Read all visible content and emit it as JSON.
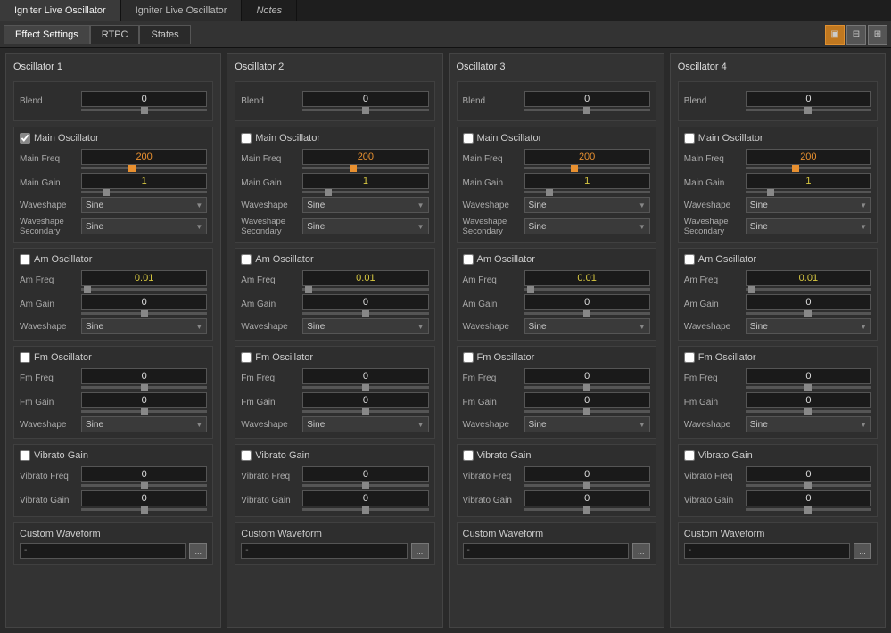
{
  "titleTabs": [
    {
      "label": "Igniter Live Oscillator",
      "active": true
    },
    {
      "label": "Igniter Live Oscillator",
      "active": false
    },
    {
      "label": "Notes",
      "active": false,
      "italic": true
    }
  ],
  "toolbar": {
    "tabs": [
      {
        "label": "Effect Settings",
        "active": true
      },
      {
        "label": "RTPC",
        "active": false
      },
      {
        "label": "States",
        "active": false
      }
    ],
    "icons": [
      {
        "name": "single-panel-icon",
        "symbol": "▣",
        "active": true
      },
      {
        "name": "dual-panel-icon",
        "symbol": "⊟",
        "active": false
      },
      {
        "name": "quad-panel-icon",
        "symbol": "⊞",
        "active": false
      }
    ]
  },
  "oscillators": [
    {
      "title": "Oscillator 1",
      "blend": "0",
      "mainOscillator": {
        "enabled": true,
        "mainFreq": "200",
        "mainGain": "1",
        "waveshape": "Sine",
        "waveshapeSecondary": "Sine"
      },
      "amOscillator": {
        "enabled": false,
        "amFreq": "0.01",
        "amGain": "0",
        "waveshape": "Sine"
      },
      "fmOscillator": {
        "enabled": false,
        "fmFreq": "0",
        "fmGain": "0",
        "waveshape": "Sine"
      },
      "vibrato": {
        "enabled": false,
        "vibratoFreq": "0",
        "vibratoGain": "0"
      },
      "customWaveform": "-"
    },
    {
      "title": "Oscillator 2",
      "blend": "0",
      "mainOscillator": {
        "enabled": false,
        "mainFreq": "200",
        "mainGain": "1",
        "waveshape": "Sine",
        "waveshapeSecondary": "Sine"
      },
      "amOscillator": {
        "enabled": false,
        "amFreq": "0.01",
        "amGain": "0",
        "waveshape": "Sine"
      },
      "fmOscillator": {
        "enabled": false,
        "fmFreq": "0",
        "fmGain": "0",
        "waveshape": "Sine"
      },
      "vibrato": {
        "enabled": false,
        "vibratoFreq": "0",
        "vibratoGain": "0"
      },
      "customWaveform": "-"
    },
    {
      "title": "Oscillator 3",
      "blend": "0",
      "mainOscillator": {
        "enabled": false,
        "mainFreq": "200",
        "mainGain": "1",
        "waveshape": "Sine",
        "waveshapeSecondary": "Sine"
      },
      "amOscillator": {
        "enabled": false,
        "amFreq": "0.01",
        "amGain": "0",
        "waveshape": "Sine"
      },
      "fmOscillator": {
        "enabled": false,
        "fmFreq": "0",
        "fmGain": "0",
        "waveshape": "Sine"
      },
      "vibrato": {
        "enabled": false,
        "vibratoFreq": "0",
        "vibratoGain": "0"
      },
      "customWaveform": "-"
    },
    {
      "title": "Oscillator 4",
      "blend": "0",
      "mainOscillator": {
        "enabled": false,
        "mainFreq": "200",
        "mainGain": "1",
        "waveshape": "Sine",
        "waveshapeSecondary": "Sine"
      },
      "amOscillator": {
        "enabled": false,
        "amFreq": "0.01",
        "amGain": "0",
        "waveshape": "Sine"
      },
      "fmOscillator": {
        "enabled": false,
        "fmFreq": "0",
        "fmGain": "0",
        "waveshape": "Sine"
      },
      "vibrato": {
        "enabled": false,
        "vibratoFreq": "0",
        "vibratoGain": "0"
      },
      "customWaveform": "-"
    }
  ],
  "labels": {
    "blend": "Blend",
    "mainOscillator": "Main Oscillator",
    "mainFreq": "Main Freq",
    "mainGain": "Main Gain",
    "waveshape": "Waveshape",
    "waveshapeSecondary": "Waveshape Secondary",
    "amOscillator": "Am Oscillator",
    "amFreq": "Am Freq",
    "amGain": "Am Gain",
    "fmOscillator": "Fm Oscillator",
    "fmFreq": "Fm Freq",
    "fmGain": "Fm Gain",
    "vibratoGain": "Vibrato Gain",
    "vibratoFreq": "Vibrato Freq",
    "customWaveform": "Custom Waveform",
    "dotdotdot": "..."
  }
}
